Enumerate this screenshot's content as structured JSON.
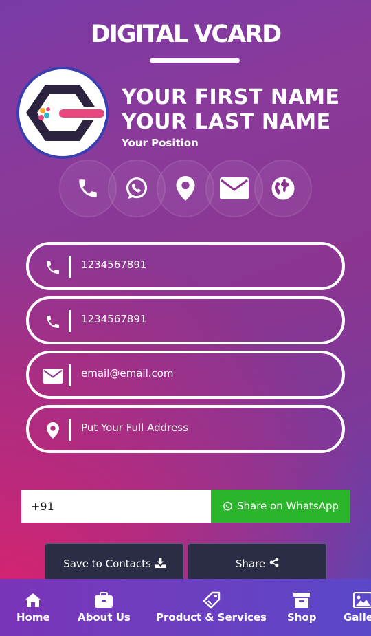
{
  "header": {
    "title": "DIGITAL VCARD"
  },
  "profile": {
    "first_name": "YOUR FIRST NAME",
    "last_name": "YOUR LAST NAME",
    "position": "Your Position"
  },
  "quick_actions": [
    {
      "icon": "phone-icon"
    },
    {
      "icon": "whatsapp-icon"
    },
    {
      "icon": "location-pin-icon"
    },
    {
      "icon": "envelope-icon"
    },
    {
      "icon": "globe-icon"
    }
  ],
  "contact_fields": [
    {
      "icon": "phone-icon",
      "value": "1234567891"
    },
    {
      "icon": "phone-icon",
      "value": "1234567891"
    },
    {
      "icon": "envelope-icon",
      "value": "email@email.com"
    },
    {
      "icon": "location-pin-icon",
      "value": "Put Your Full Address"
    }
  ],
  "share": {
    "phone_value": "+91",
    "whatsapp_label": "Share on WhatsApp"
  },
  "actions": {
    "save_label": "Save to Contacts",
    "share_label": "Share"
  },
  "bottom_nav": [
    {
      "icon": "home-icon",
      "label": "Home"
    },
    {
      "icon": "briefcase-icon",
      "label": "About Us"
    },
    {
      "icon": "tag-icon",
      "label": "Product & Services"
    },
    {
      "icon": "archive-box-icon",
      "label": "Shop"
    },
    {
      "icon": "image-icon",
      "label": "Galle"
    }
  ],
  "colors": {
    "whatsapp_green": "#2bb52b",
    "dark_button": "#2a2d45",
    "nav_bg": "#6c3fc0"
  }
}
